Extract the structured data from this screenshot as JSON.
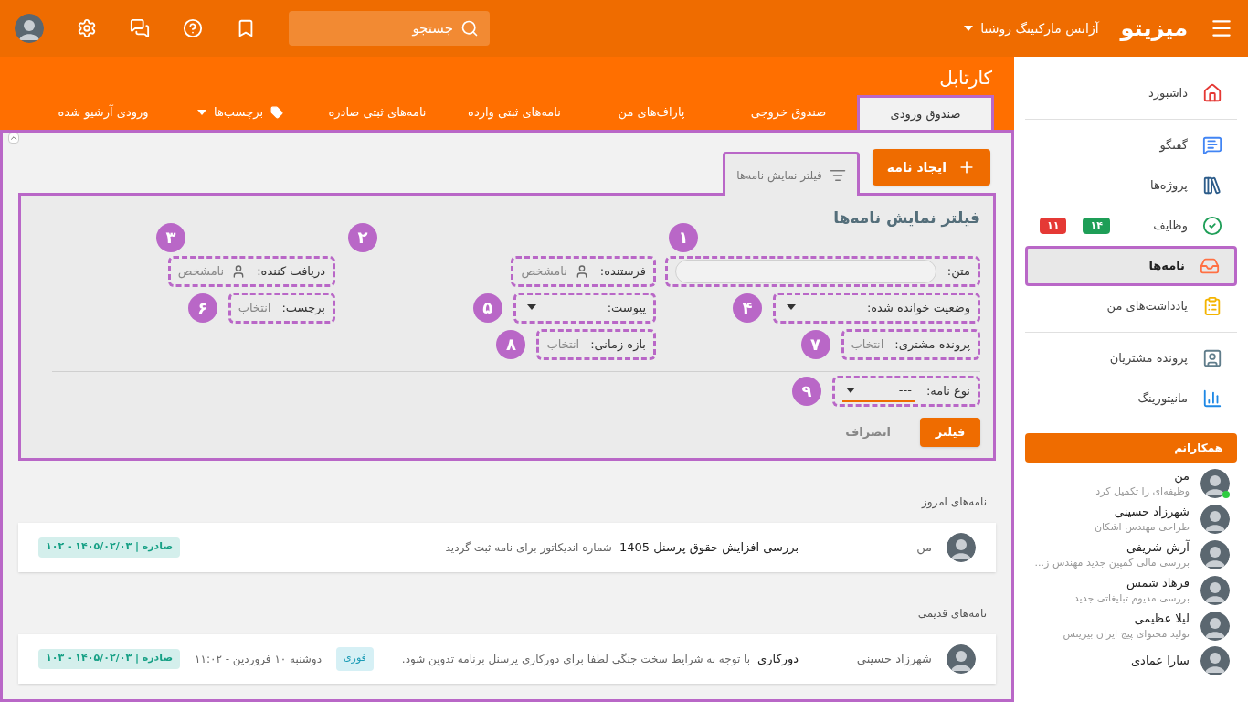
{
  "topbar": {
    "logo": "میزیتو",
    "company": "آژانس مارکتینگ روشنا",
    "search": {
      "placeholder": "جستجو"
    }
  },
  "header": {
    "title": "کارتابل"
  },
  "tabs": [
    {
      "label": "صندوق ورودی",
      "selected": true,
      "highlighted": true,
      "kind": "plain"
    },
    {
      "label": "صندوق خروجی",
      "selected": false,
      "highlighted": false,
      "kind": "plain"
    },
    {
      "label": "پاراف‌های من",
      "selected": false,
      "highlighted": false,
      "kind": "plain"
    },
    {
      "label": "نامه‌های ثبتی وارده",
      "selected": false,
      "highlighted": false,
      "kind": "plain"
    },
    {
      "label": "نامه‌های ثبتی صادره",
      "selected": false,
      "highlighted": false,
      "kind": "plain"
    },
    {
      "label": "برچسب‌ها",
      "selected": false,
      "highlighted": false,
      "kind": "dropdown"
    },
    {
      "label": "ورودی آرشیو شده",
      "selected": false,
      "highlighted": false,
      "kind": "plain"
    }
  ],
  "create_button": "ایجاد نامه",
  "filter_tab": {
    "label": "فیلتر نمایش نامه‌ها",
    "highlighted": true
  },
  "filter": {
    "title": "فیلتر نمایش نامه‌ها",
    "highlighted": true,
    "rows": [
      [
        {
          "label": "متن:",
          "kind": "text",
          "marker": "۱"
        },
        {
          "label": "فرستنده:",
          "kind": "person",
          "placeholder": "نامشخص",
          "marker": "۲"
        },
        {
          "label": "دریافت کننده:",
          "kind": "person",
          "placeholder": "نامشخص",
          "marker": "۳"
        }
      ],
      [
        {
          "label": "وضعیت خوانده شده:",
          "kind": "select",
          "marker": "۴"
        },
        {
          "label": "پیوست:",
          "kind": "select",
          "marker": "۵"
        },
        {
          "label": "برچسب:",
          "kind": "picker",
          "placeholder": "انتخاب",
          "marker": "۶"
        }
      ],
      [
        {
          "label": "پرونده مشتری:",
          "kind": "picker",
          "placeholder": "انتخاب",
          "marker": "۷"
        },
        {
          "label": "بازه زمانی:",
          "kind": "picker",
          "placeholder": "انتخاب",
          "marker": "۸"
        }
      ]
    ],
    "type_field": {
      "label": "نوع نامه:",
      "kind": "select",
      "value": "---",
      "marker": "۹",
      "focused": true
    },
    "apply": "فیلتر",
    "cancel": "انصراف"
  },
  "sections": [
    {
      "title": "نامه‌های امروز",
      "letters": [
        {
          "sender": "من",
          "subject": "بررسی افزایش حقوق پرسنل 1405",
          "preview": "شماره اندیکاتور برای نامه ثبت گردید",
          "reference": "۱۰۲ - ۱۴۰۵/۰۲/۰۳ | صادره"
        }
      ]
    },
    {
      "title": "نامه‌های قدیمی",
      "letters": [
        {
          "sender": "شهرزاد حسینی",
          "subject": "دورکاری",
          "preview": "با توجه به شرایط سخت جنگی لطفا برای دورکاری پرسنل برنامه تدوین شود.",
          "tag": "فوری",
          "date": "دوشنبه ۱۰ فروردین - ۱۱:۰۲",
          "reference": "۱۰۳ - ۱۴۰۵/۰۲/۰۳ | صادره"
        }
      ]
    }
  ],
  "sidebar": {
    "groups": [
      [
        {
          "label": "داشبورد",
          "selected": false,
          "highlighted": false
        }
      ],
      [
        {
          "label": "گفتگو",
          "selected": false,
          "highlighted": false
        },
        {
          "label": "پروژه‌ها",
          "selected": false,
          "highlighted": false
        },
        {
          "label": "وظایف",
          "selected": false,
          "highlighted": false,
          "badges": [
            {
              "text": "۱۴",
              "color": "#1e9e57"
            },
            {
              "text": "۱۱",
              "color": "#e53935"
            }
          ]
        },
        {
          "label": "نامه‌ها",
          "selected": true,
          "highlighted": true
        },
        {
          "label": "یادداشت‌های من",
          "selected": false,
          "highlighted": false
        }
      ],
      [
        {
          "label": "پرونده مشتریان",
          "selected": false,
          "highlighted": false
        },
        {
          "label": "مانیتورینگ",
          "selected": false,
          "highlighted": false
        }
      ]
    ],
    "colleagues_title": "همکارانم",
    "colleagues": [
      {
        "name": "من",
        "status": "وظیفه‌ای را تکمیل کرد",
        "online": true
      },
      {
        "name": "شهرزاد حسینی",
        "status": "طراحی مهندس اشکان",
        "online": false
      },
      {
        "name": "آرش شریفی",
        "status": "بررسی مالی کمپین جدید مهندس ز...",
        "online": false
      },
      {
        "name": "فرهاد شمس",
        "status": "بررسی مدیوم تبلیغاتی جدید",
        "online": false
      },
      {
        "name": "لیلا عظیمی",
        "status": "تولید محتوای پیج ایران بیزینس",
        "online": false
      },
      {
        "name": "سارا عمادی",
        "online": false
      }
    ]
  }
}
